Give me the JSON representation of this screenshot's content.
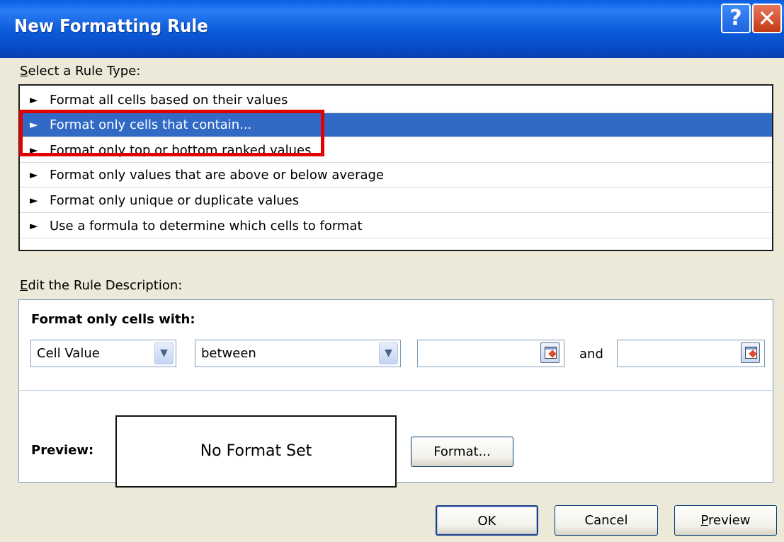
{
  "window": {
    "title": "New Formatting Rule",
    "help_glyph": "?",
    "close_glyph": "✕"
  },
  "rule_type": {
    "label": "Select a Rule Type:",
    "label_mnemonic": "S",
    "label_rest": "elect a Rule Type:",
    "arrow": "►",
    "items": [
      "Format all cells based on their values",
      "Format only cells that contain...",
      "Format only top or bottom ranked values",
      "Format only values that are above or below average",
      "Format only unique or duplicate values",
      "Use a formula to determine which cells to format"
    ],
    "selected_index": 1
  },
  "description": {
    "label": "Edit the Rule Description:",
    "label_mnemonic": "E",
    "label_rest": "dit the Rule Description:",
    "heading": "Format only cells with:",
    "field1_value": "Cell Value",
    "operator_value": "between",
    "value1": "",
    "and_label": "and",
    "value2": "",
    "preview_label": "Preview:",
    "preview_text": "No Format Set",
    "format_button": "Format..."
  },
  "buttons": {
    "ok": "OK",
    "cancel": "Cancel",
    "preview": "Preview",
    "preview_mnemonic": "P",
    "preview_rest": "review"
  },
  "colors": {
    "selection": "#316ac5",
    "highlight_box": "#e00000",
    "titlebar": "#0a5ee0"
  },
  "icons": {
    "dropdown": "chevron-down-icon",
    "range_picker": "range-select-icon",
    "help": "help-icon",
    "close": "close-icon"
  }
}
